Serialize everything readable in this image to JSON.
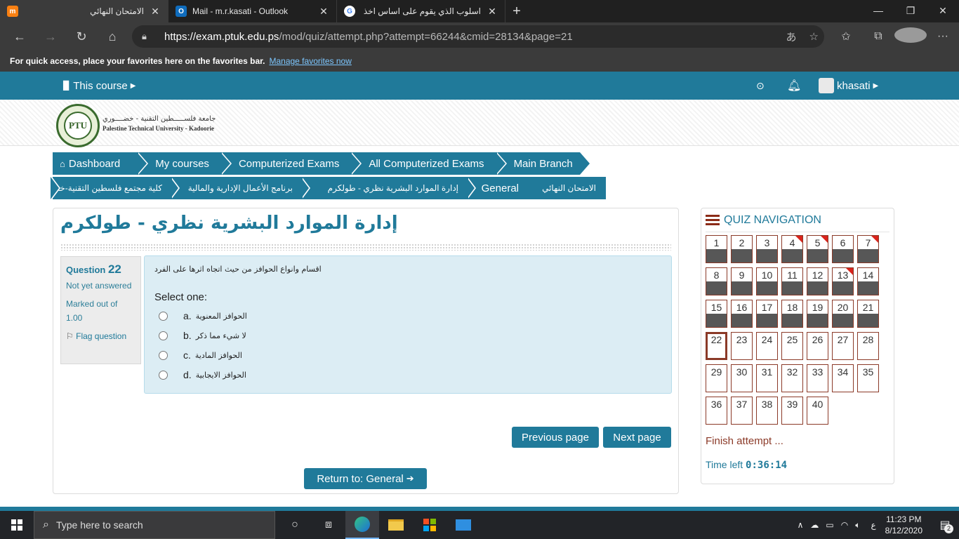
{
  "browser": {
    "tabs": [
      {
        "icon": "moodle-icon",
        "title": "الامتحان النهائي",
        "rtl": true,
        "active": true
      },
      {
        "icon": "outlook-icon",
        "title": "Mail - m.r.kasati - Outlook",
        "rtl": false,
        "active": false
      },
      {
        "icon": "google-icon",
        "title": "اسلوب الذي يقوم على اساس اخذ ال",
        "rtl": true,
        "active": false
      }
    ],
    "url_host": "https://exam.ptuk.edu.ps",
    "url_path": "/mod/quiz/attempt.php?attempt=66244&cmid=28134&page=21",
    "favbar_text": "For quick access, place your favorites here on the favorites bar.",
    "favbar_link": "Manage favorites now"
  },
  "topnav": {
    "course_label": "This course",
    "user_name": "khasati"
  },
  "logo": {
    "arabic": "جامعة فلســـــطين التقنية - خضــــوري",
    "english": "Palestine Technical University - Kadoorie",
    "mark": "PTU"
  },
  "breadcrumb1": [
    "Dashboard",
    "My courses",
    "Computerized Exams",
    "All Computerized Exams",
    "Main Branch"
  ],
  "breadcrumb2": [
    "الامتحان النهائي",
    "General",
    "إدارة الموارد البشرية نظري - طولكرم",
    "برنامج الأعمال الإدارية والمالية",
    "كلية مجتمع فلسطين التقنية-خضوري"
  ],
  "page_title": "إدارة الموارد البشرية نظري - طولكرم",
  "question": {
    "label": "Question",
    "number": "22",
    "status": "Not yet answered",
    "marked_out_of": "Marked out of 1.00",
    "flag_label": "Flag question",
    "text": "اقسام وانواع الحوافز من حيث اتجاه اثرها على الفرد",
    "select_one": "Select one:",
    "options": [
      {
        "letter": "a.",
        "text": "الحوافز المعنوية"
      },
      {
        "letter": "b.",
        "text": "لا شيء مما ذكر"
      },
      {
        "letter": "c.",
        "text": "الحوافز المادية"
      },
      {
        "letter": "d.",
        "text": "الحوافز الايجابية"
      }
    ]
  },
  "buttons": {
    "previous": "Previous page",
    "next": "Next page",
    "return": "Return to: General"
  },
  "quiz_nav": {
    "title": "QUIZ NAVIGATION",
    "finish": "Finish attempt ...",
    "time_left_label": "Time left",
    "time_left": "0:36:14",
    "current": 22,
    "answered_up_to": 21,
    "total": 40,
    "flagged": [
      4,
      5,
      7,
      13
    ]
  },
  "taskbar": {
    "search_placeholder": "Type here to search",
    "time": "11:23 PM",
    "date": "8/12/2020",
    "lang": "ع",
    "notifications": "2"
  },
  "colors": {
    "primary": "#207a9a",
    "accent": "#8b3a28",
    "flag": "#d9241c"
  }
}
